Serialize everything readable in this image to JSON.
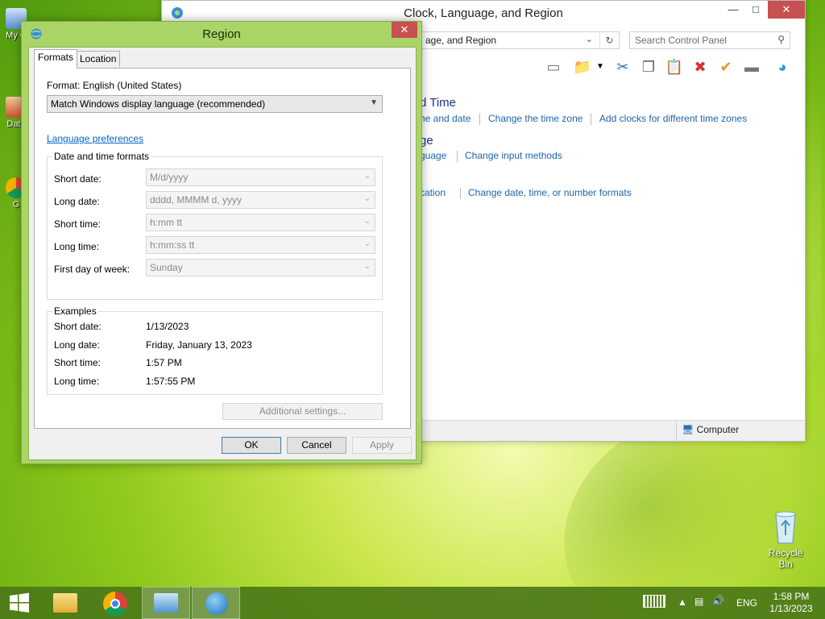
{
  "desktop": {
    "icons": [
      {
        "label": "My C"
      },
      {
        "label": "Data"
      },
      {
        "label": "G"
      }
    ],
    "recycle_bin": "Recycle Bin"
  },
  "control_panel": {
    "title": "Clock, Language, and Region",
    "address": "age, and Region",
    "search_placeholder": "Search Control Panel",
    "sections": [
      {
        "heading": "d Time",
        "links": [
          "he and date",
          "Change the time zone",
          "Add clocks for different time zones"
        ]
      },
      {
        "heading": "ge",
        "links": [
          "guage",
          "Change input methods"
        ]
      },
      {
        "heading": "",
        "links": [
          "cation",
          "Change date, time, or number formats"
        ]
      }
    ],
    "status_location": "Computer"
  },
  "region_dialog": {
    "title": "Region",
    "tabs": [
      "Formats",
      "Location"
    ],
    "format_label": "Format: English (United States)",
    "format_value": "Match Windows display language (recommended)",
    "language_pref_link": "Language preferences",
    "dt_group_title": "Date and time formats",
    "dt_formats": [
      {
        "label": "Short date:",
        "value": "M/d/yyyy"
      },
      {
        "label": "Long date:",
        "value": "dddd, MMMM d, yyyy"
      },
      {
        "label": "Short time:",
        "value": "h:mm tt"
      },
      {
        "label": "Long time:",
        "value": "h:mm:ss tt"
      },
      {
        "label": "First day of week:",
        "value": "Sunday"
      }
    ],
    "examples_title": "Examples",
    "examples": [
      {
        "label": "Short date:",
        "value": "1/13/2023"
      },
      {
        "label": "Long date:",
        "value": "Friday, January 13, 2023"
      },
      {
        "label": "Short time:",
        "value": "1:57 PM"
      },
      {
        "label": "Long time:",
        "value": "1:57:55 PM"
      }
    ],
    "additional_settings": "Additional settings...",
    "ok": "OK",
    "cancel": "Cancel",
    "apply": "Apply"
  },
  "taskbar": {
    "language": "ENG",
    "time": "1:58 PM",
    "date": "1/13/2023"
  }
}
